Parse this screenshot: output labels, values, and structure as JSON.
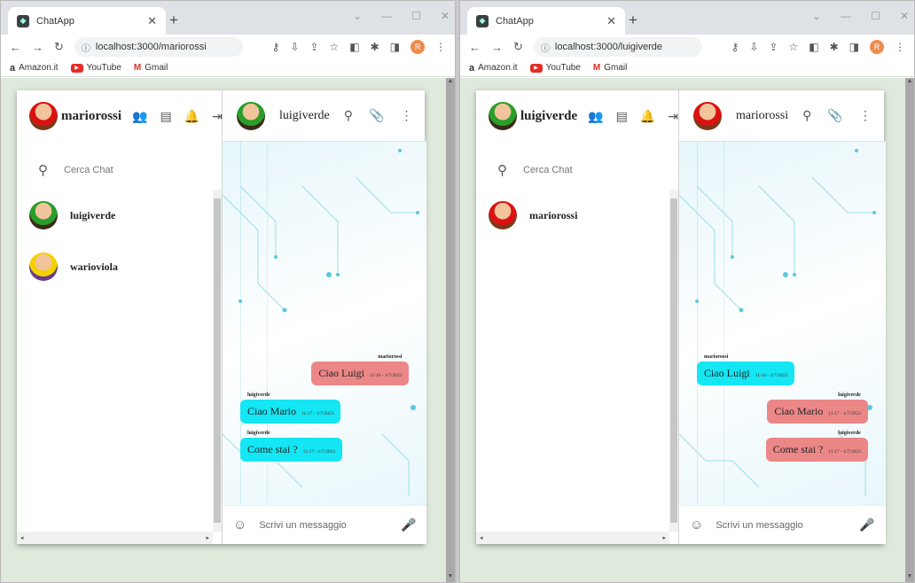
{
  "windows": [
    {
      "tab_title": "ChatApp",
      "url": "localhost:3000/mariorossi",
      "bookmarks": [
        "Amazon.it",
        "YouTube",
        "Gmail"
      ],
      "profile_initial": "R",
      "current_user": "mariorossi",
      "search_placeholder": "Cerca Chat",
      "chats": [
        "luigiverde",
        "warioviola"
      ],
      "open_chat": "luigiverde",
      "messages": [
        {
          "sender": "mariorossi",
          "text": "Ciao Luigi",
          "time": "11:16 - 1/7/2023",
          "side": "mine",
          "color": "red"
        },
        {
          "sender": "luigiverde",
          "text": "Ciao Mario",
          "time": "11:17 - 1/7/2023",
          "side": "theirs",
          "color": "cyan"
        },
        {
          "sender": "luigiverde",
          "text": "Come stai ?",
          "time": "11:17 - 1/7/2023",
          "side": "theirs",
          "color": "cyan"
        }
      ],
      "input_placeholder": "Scrivi un messaggio"
    },
    {
      "tab_title": "ChatApp",
      "url": "localhost:3000/luigiverde",
      "bookmarks": [
        "Amazon.it",
        "YouTube",
        "Gmail"
      ],
      "profile_initial": "R",
      "current_user": "luigiverde",
      "search_placeholder": "Cerca Chat",
      "chats": [
        "mariorossi"
      ],
      "open_chat": "mariorossi",
      "messages": [
        {
          "sender": "mariorossi",
          "text": "Ciao Luigi",
          "time": "11:16 - 1/7/2023",
          "side": "theirs",
          "color": "cyan"
        },
        {
          "sender": "luigiverde",
          "text": "Ciao Mario",
          "time": "11:17 - 1/7/2023",
          "side": "mine",
          "color": "red"
        },
        {
          "sender": "luigiverde",
          "text": "Come stai ?",
          "time": "11:17 - 1/7/2023",
          "side": "mine",
          "color": "red"
        }
      ],
      "input_placeholder": "Scrivi un messaggio"
    }
  ],
  "colors": {
    "bubble_red": "#ec8787",
    "bubble_cyan": "#14e6f3",
    "page_bg": "#dfeadc"
  }
}
